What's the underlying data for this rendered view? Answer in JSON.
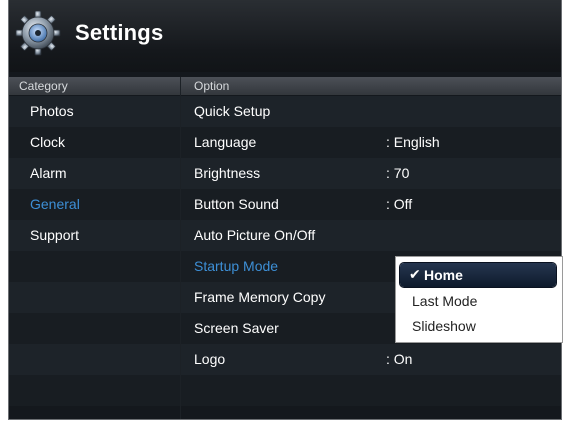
{
  "window": {
    "title": "Settings",
    "icon": "gear-icon"
  },
  "headers": {
    "category": "Category",
    "option": "Option"
  },
  "categories": [
    "Photos",
    "Clock",
    "Alarm",
    "General",
    "Support"
  ],
  "selected_category": "General",
  "options": [
    {
      "label": "Quick Setup",
      "value": ""
    },
    {
      "label": "Language",
      "value": ": English"
    },
    {
      "label": "Brightness",
      "value": ": 70"
    },
    {
      "label": "Button Sound",
      "value": ": Off"
    },
    {
      "label": "Auto Picture On/Off",
      "value": ""
    },
    {
      "label": "Startup Mode",
      "value": ""
    },
    {
      "label": "Frame Memory Copy",
      "value": ""
    },
    {
      "label": "Screen Saver",
      "value": ""
    },
    {
      "label": "Logo",
      "value": ": On"
    }
  ],
  "selected_option": "Startup Mode",
  "popup": {
    "items": [
      "Home",
      "Last Mode",
      "Slideshow"
    ],
    "selected": "Home",
    "check_icon": "checkmark-icon"
  },
  "colors": {
    "highlight": "#3d8fd6",
    "background": "#14181d",
    "popup_selected": "#1a2840"
  }
}
